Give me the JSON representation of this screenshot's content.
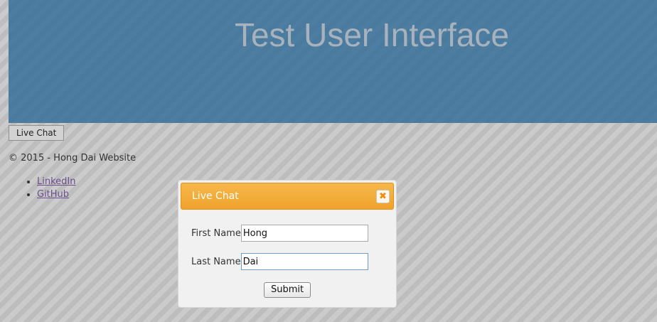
{
  "header": {
    "title": "Test User Interface"
  },
  "live_chat_button": {
    "label": "Live Chat"
  },
  "footer": {
    "copyright": "© 2015 - Hong Dai Website",
    "links": [
      {
        "label": "LinkedIn"
      },
      {
        "label": "GitHub"
      }
    ]
  },
  "dialog": {
    "title": "Live Chat",
    "close_icon": "close-icon",
    "first_name_label": "First Name",
    "first_name_value": "Hong",
    "last_name_label": "Last Name",
    "last_name_value": "Dai",
    "submit_label": "Submit"
  },
  "colors": {
    "header_bg": "#4f7fa3",
    "dialog_title_bg": "#f0a22c",
    "link": "#6b4d8f"
  }
}
